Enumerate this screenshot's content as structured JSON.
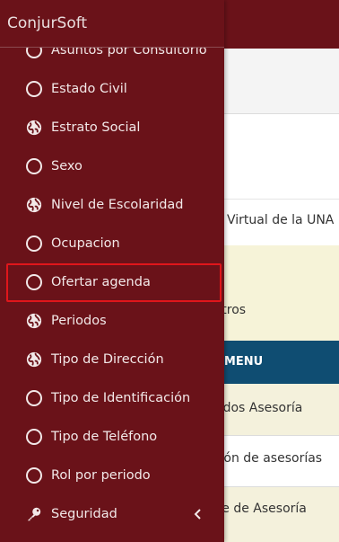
{
  "app": {
    "brand": "ConjurSoft"
  },
  "background": {
    "text1": "o Virtual de la UNA",
    "text2": "stros",
    "submenu_header": "BMENU",
    "row1": "ados Asesoría",
    "row2": "tión de asesorías",
    "row3": "se de Asesoría"
  },
  "sidebar": {
    "items": [
      {
        "label": "Asuntos por Consultorio",
        "icon": "circle-outline-icon"
      },
      {
        "label": "Estado Civil",
        "icon": "circle-outline-icon"
      },
      {
        "label": "Estrato Social",
        "icon": "globe-icon"
      },
      {
        "label": "Sexo",
        "icon": "circle-outline-icon"
      },
      {
        "label": "Nivel de Escolaridad",
        "icon": "globe-icon"
      },
      {
        "label": "Ocupacion",
        "icon": "circle-outline-icon"
      },
      {
        "label": "Ofertar agenda",
        "icon": "circle-outline-icon"
      },
      {
        "label": "Periodos",
        "icon": "globe-icon"
      },
      {
        "label": "Tipo de Dirección",
        "icon": "globe-icon"
      },
      {
        "label": "Tipo de Identificación",
        "icon": "circle-outline-icon"
      },
      {
        "label": "Tipo de Teléfono",
        "icon": "circle-outline-icon"
      },
      {
        "label": "Rol por periodo",
        "icon": "circle-outline-icon"
      },
      {
        "label": "Seguridad",
        "icon": "key-icon"
      }
    ]
  },
  "colors": {
    "sidebar_bg": "#6a1219",
    "highlight_border": "#e0161b",
    "submenu_header_bg": "#0f4d72",
    "row_tint": "#f4f1dc"
  }
}
